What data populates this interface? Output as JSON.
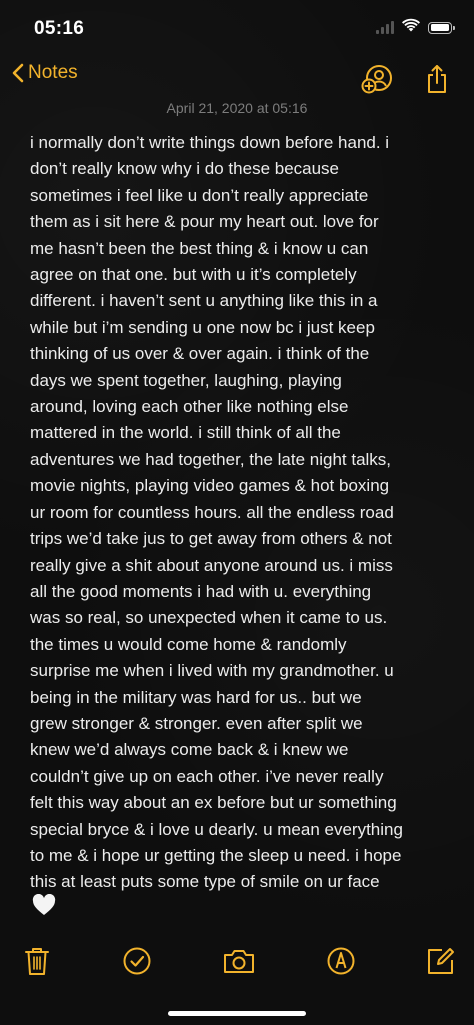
{
  "status_bar": {
    "time": "05:16"
  },
  "nav": {
    "back_label": "Notes",
    "accent_color": "#f2b32c"
  },
  "note": {
    "date": "April 21, 2020 at 05:16",
    "lines": [
      "i normally don’t write things down before hand. i",
      "don’t really know why i do these because",
      "sometimes i feel like u don’t really appreciate",
      "them as i sit here & pour my heart out. love for",
      "me hasn’t been the best thing & i know u can",
      "agree on that one. but with u it’s completely",
      "different. i haven’t sent u anything like this in a",
      "while but i’m sending u one now bc i just keep",
      "thinking of us over & over again. i think of the",
      "days we spent together, laughing, playing",
      "around, loving each other like nothing else",
      "mattered in the world. i still think of all the",
      "adventures we had together, the late night talks,",
      "movie nights, playing video games & hot boxing",
      "ur room for countless hours. all the endless road",
      "trips we’d take jus to get away from others & not",
      "really give a shit about anyone around us. i miss",
      "all the good moments i had with u. everything",
      "was so real, so unexpected when it came to us.",
      "the times u would come home & randomly",
      "surprise me when i lived with my grandmother. u",
      "being in the military was hard for us.. but we",
      "grew stronger & stronger. even after split we",
      "knew we’d always come back & i knew we",
      "couldn’t give up on each other. i’ve never really",
      "felt this way about an ex before but ur something",
      "special bryce & i love u dearly. u mean everything",
      "to me & i hope ur getting the sleep u need. i hope",
      "this at least puts some type of smile on ur face"
    ],
    "emoji": "white-heart-icon"
  },
  "toolbar": {
    "icons": [
      "trash-icon",
      "checklist-icon",
      "camera-icon",
      "markup-icon",
      "compose-icon"
    ]
  }
}
